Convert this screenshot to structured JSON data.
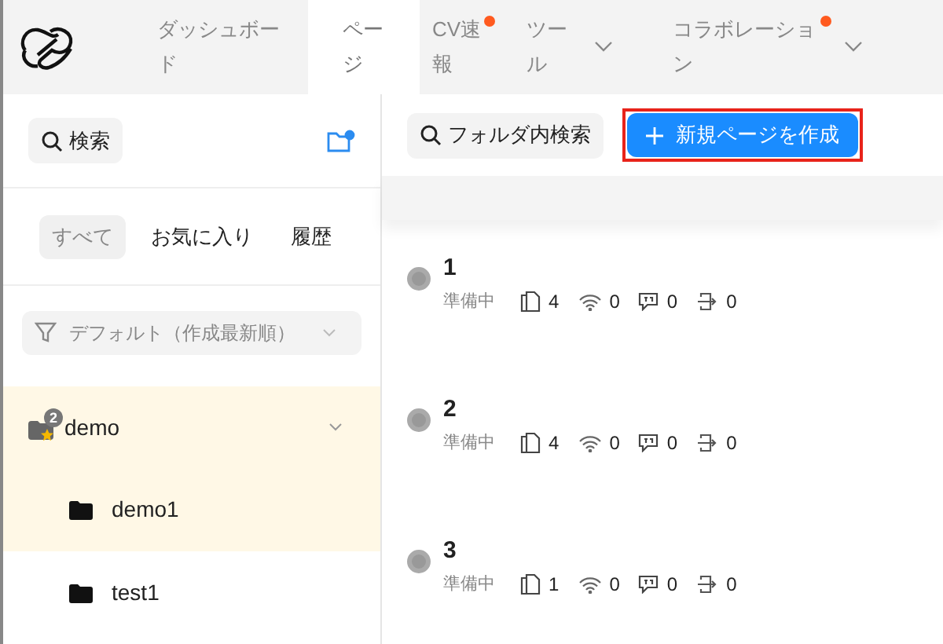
{
  "nav": {
    "tabs": [
      {
        "label": "ダッシュボード",
        "selected": false,
        "dot": false,
        "dropdown": false
      },
      {
        "label": "ページ",
        "selected": true,
        "dot": false,
        "dropdown": false
      },
      {
        "label": "CV速報",
        "selected": false,
        "dot": true,
        "dropdown": false
      },
      {
        "label": "ツール",
        "selected": false,
        "dot": false,
        "dropdown": true
      },
      {
        "label": "コラボレーション",
        "selected": false,
        "dot": true,
        "dropdown": true
      }
    ]
  },
  "sidebar": {
    "search_button": "検索",
    "filters": [
      {
        "label": "すべて",
        "selected": true
      },
      {
        "label": "お気に入り",
        "selected": false
      },
      {
        "label": "履歴",
        "selected": false
      }
    ],
    "sort": "デフォルト（作成最新順）",
    "folders": [
      {
        "name": "demo",
        "badge": "2",
        "expanded": true,
        "selected": true,
        "children": [
          {
            "name": "demo1",
            "selected": true
          },
          {
            "name": "test1",
            "selected": false
          }
        ]
      }
    ]
  },
  "main": {
    "search_button": "フォルダ内検索",
    "create_button": "新規ページを作成",
    "pages": [
      {
        "title": "1",
        "status": "準備中",
        "stats": [
          {
            "kind": "pages",
            "value": "4"
          },
          {
            "kind": "wifi",
            "value": "0"
          },
          {
            "kind": "comments",
            "value": "0"
          },
          {
            "kind": "exits",
            "value": "0"
          }
        ]
      },
      {
        "title": "2",
        "status": "準備中",
        "stats": [
          {
            "kind": "pages",
            "value": "4"
          },
          {
            "kind": "wifi",
            "value": "0"
          },
          {
            "kind": "comments",
            "value": "0"
          },
          {
            "kind": "exits",
            "value": "0"
          }
        ]
      },
      {
        "title": "3",
        "status": "準備中",
        "stats": [
          {
            "kind": "pages",
            "value": "1"
          },
          {
            "kind": "wifi",
            "value": "0"
          },
          {
            "kind": "comments",
            "value": "0"
          },
          {
            "kind": "exits",
            "value": "0"
          }
        ]
      }
    ]
  }
}
